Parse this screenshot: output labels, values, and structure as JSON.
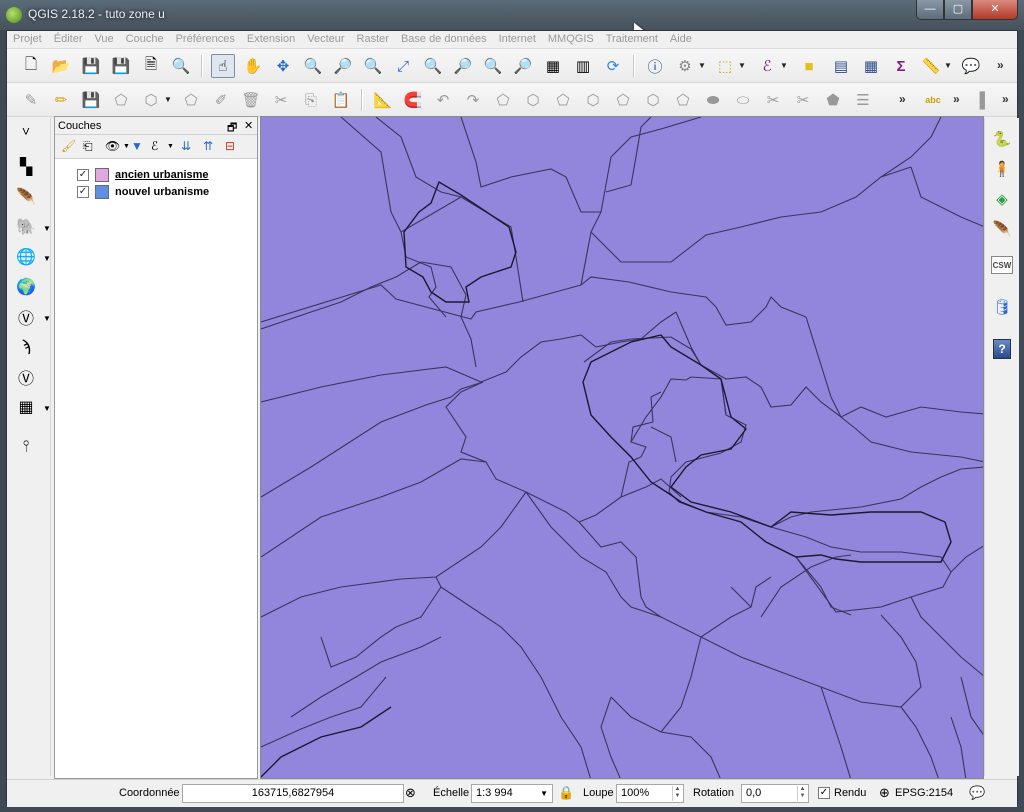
{
  "window": {
    "title": "QGIS 2.18.2 - tuto zone u",
    "minimize_glyph": "—",
    "maximize_glyph": "▢",
    "close_glyph": "✕"
  },
  "menu": [
    "Projet",
    "Éditer",
    "Vue",
    "Couche",
    "Préférences",
    "Extension",
    "Vecteur",
    "Raster",
    "Base de données",
    "Internet",
    "MMQGIS",
    "Traitement",
    "Aide"
  ],
  "toolbar_more": "»",
  "layers_panel": {
    "title": "Couches",
    "float_glyph": "🗗",
    "close_glyph": "✕",
    "layers": [
      {
        "name": "ancien urbanisme",
        "checked": true,
        "color": "#e0a8dc",
        "selected": true
      },
      {
        "name": "nouvel urbanisme",
        "checked": true,
        "color": "#5f8fe0",
        "selected": false
      }
    ]
  },
  "map": {
    "fill_color": "#9186db"
  },
  "status": {
    "coord_label": "Coordonnée",
    "coord_value": "163715,6827954",
    "scale_label": "Échelle",
    "scale_value": "1:3 994",
    "magnifier_label": "Loupe",
    "magnifier_value": "100%",
    "rotation_label": "Rotation",
    "rotation_value": "0,0",
    "render_label": "Rendu",
    "crs": "EPSG:2154"
  },
  "right_toolbar": {
    "csw_label": "CSW",
    "help_label": "?"
  },
  "check_glyph": "✓"
}
